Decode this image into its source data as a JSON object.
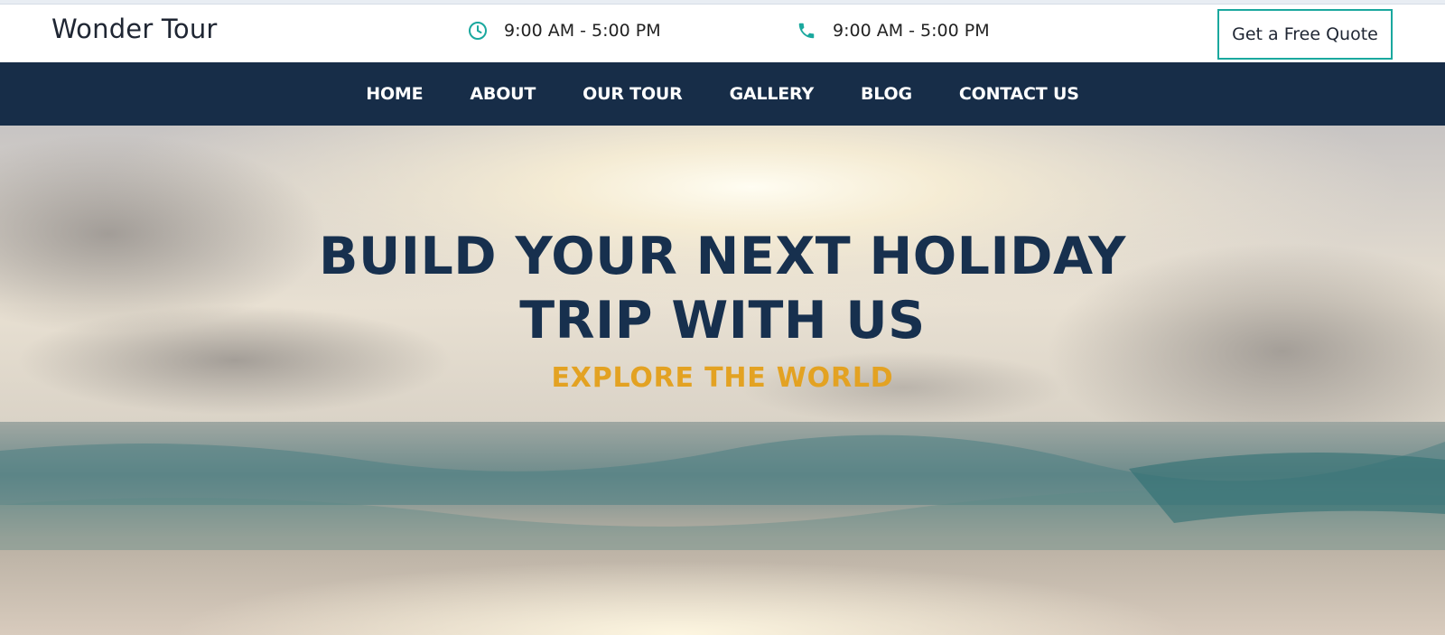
{
  "header": {
    "brand": "Wonder Tour",
    "hours_1": "9:00 AM - 5:00 PM",
    "hours_2": "9:00 AM - 5:00 PM",
    "quote_button": "Get a Free Quote",
    "icons": [
      "clock-icon",
      "phone-icon"
    ],
    "accent_color": "#1aa89e"
  },
  "nav": {
    "items": [
      "HOME",
      "ABOUT",
      "OUR TOUR",
      "GALLERY",
      "BLOG",
      "CONTACT US"
    ],
    "background": "#172d48"
  },
  "hero": {
    "title_line_1": "BUILD YOUR NEXT HOLIDAY",
    "title_line_2": "TRIP WITH US",
    "subtitle": "EXPLORE THE WORLD",
    "title_color": "#17304e",
    "subtitle_color": "#e3a222"
  }
}
